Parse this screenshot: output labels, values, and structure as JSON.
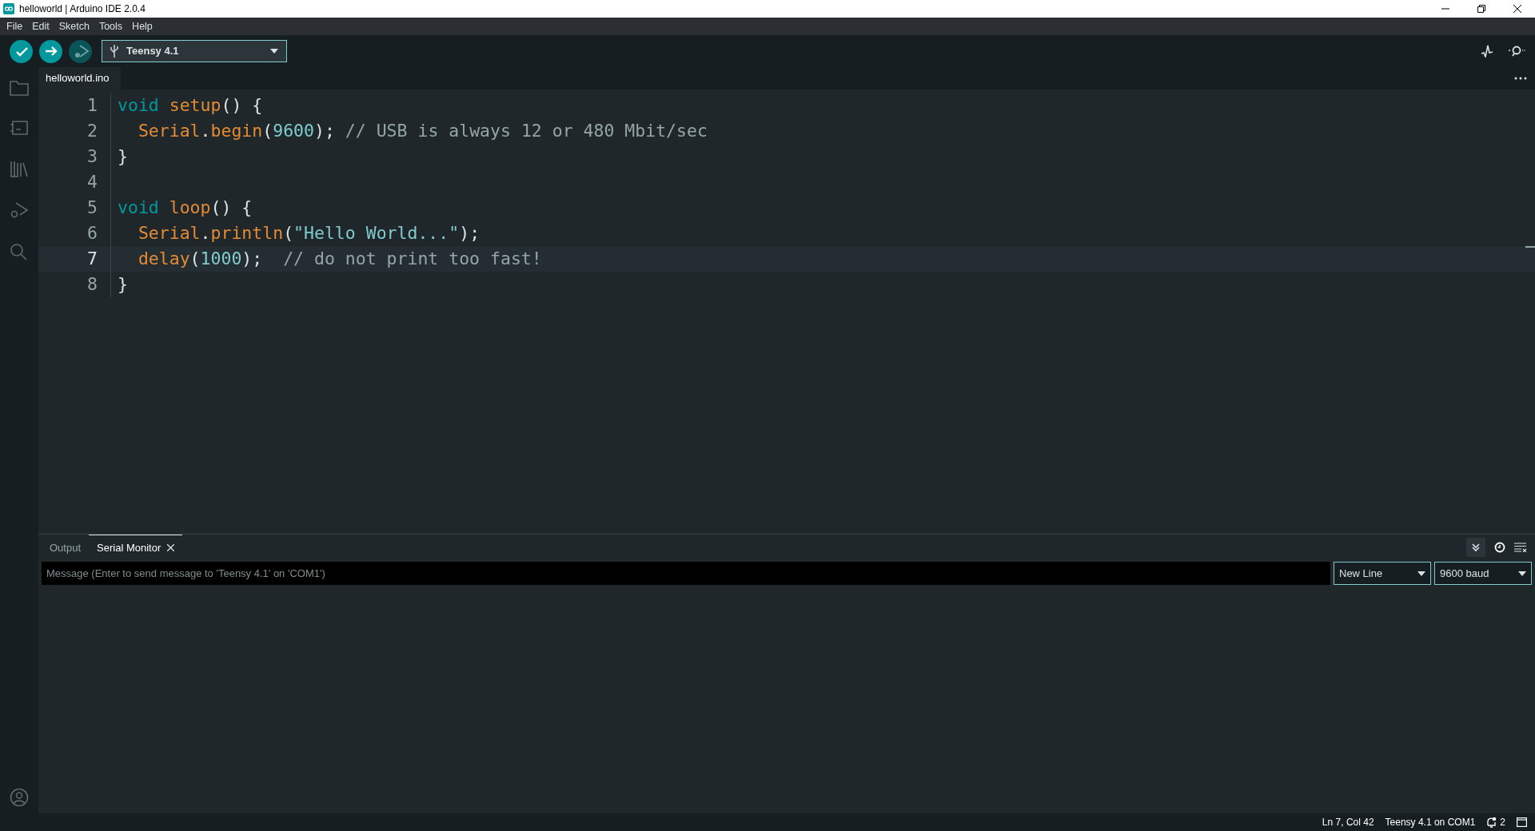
{
  "window": {
    "title": "helloworld | Arduino IDE 2.0.4"
  },
  "menu": [
    "File",
    "Edit",
    "Sketch",
    "Tools",
    "Help"
  ],
  "toolbar": {
    "buttons": [
      {
        "kind": "verify",
        "disabled": false
      },
      {
        "kind": "upload",
        "disabled": false
      },
      {
        "kind": "debug",
        "disabled": true
      }
    ],
    "board": "Teensy 4.1"
  },
  "editor": {
    "tabs": [
      {
        "label": "helloworld.ino",
        "selected": true
      }
    ],
    "lines": [
      {
        "number": "1",
        "current": false,
        "tokens": [
          {
            "kind": "keyword",
            "text": "void "
          },
          {
            "kind": "function",
            "text": "setup"
          },
          {
            "kind": "punct",
            "text": "() {"
          }
        ]
      },
      {
        "number": "2",
        "current": false,
        "tokens": [
          {
            "kind": "function",
            "text": "  Serial"
          },
          {
            "kind": "punct",
            "text": "."
          },
          {
            "kind": "function",
            "text": "begin"
          },
          {
            "kind": "punct",
            "text": "("
          },
          {
            "kind": "number",
            "text": "9600"
          },
          {
            "kind": "punct",
            "text": "); "
          },
          {
            "kind": "comment",
            "text": "// USB is always 12 or 480 Mbit/sec"
          }
        ]
      },
      {
        "number": "3",
        "current": false,
        "tokens": [
          {
            "kind": "punct",
            "text": "}"
          }
        ]
      },
      {
        "number": "4",
        "current": false
      },
      {
        "number": "5",
        "current": false,
        "tokens": [
          {
            "kind": "keyword",
            "text": "void "
          },
          {
            "kind": "function",
            "text": "loop"
          },
          {
            "kind": "punct",
            "text": "() {"
          }
        ]
      },
      {
        "number": "6",
        "current": false,
        "tokens": [
          {
            "kind": "function",
            "text": "  Serial"
          },
          {
            "kind": "punct",
            "text": "."
          },
          {
            "kind": "function",
            "text": "println"
          },
          {
            "kind": "punct",
            "text": "("
          },
          {
            "kind": "string",
            "text": "\"Hello World...\""
          },
          {
            "kind": "punct",
            "text": ");"
          }
        ]
      },
      {
        "number": "7",
        "current": true,
        "tokens": [
          {
            "kind": "function",
            "text": "  delay"
          },
          {
            "kind": "punct",
            "text": "("
          },
          {
            "kind": "number",
            "text": "1000"
          },
          {
            "kind": "punct",
            "text": ");  "
          },
          {
            "kind": "comment",
            "text": "// do not print too fast!"
          }
        ]
      },
      {
        "number": "8",
        "current": false,
        "tokens": [
          {
            "kind": "punct",
            "text": "}"
          }
        ]
      }
    ]
  },
  "panel": {
    "tabs": [
      {
        "label": "Output",
        "selected": false,
        "closable": false
      },
      {
        "label": "Serial Monitor",
        "selected": true,
        "closable": true
      }
    ],
    "autoscroll": true,
    "message": {
      "placeholder": "Message (Enter to send message to 'Teensy 4.1' on 'COM1')"
    },
    "line_ending": "New Line",
    "baud": "9600 baud"
  },
  "status_bar": {
    "position": "Ln 7, Col 42",
    "board": "Teensy 4.1 on COM1",
    "notifications": "2"
  }
}
